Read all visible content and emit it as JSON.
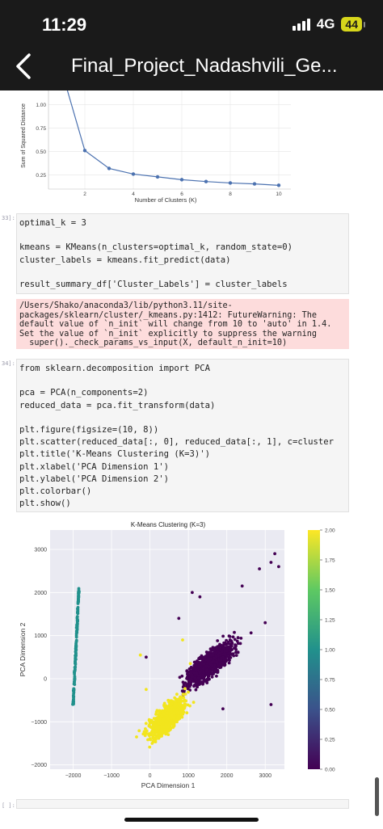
{
  "status": {
    "time": "11:29",
    "network": "4G",
    "battery": "44"
  },
  "nav": {
    "title": "Final_Project_Nadashvili_Ge..."
  },
  "elbow": {
    "ylabel": "Sum of Squared Distance",
    "xlabel": "Number of Clusters (K)",
    "x_ticks": [
      "2",
      "4",
      "6",
      "8",
      "10"
    ],
    "y_ticks": [
      "1.00",
      "0.75",
      "0.50",
      "0.25"
    ]
  },
  "cells": {
    "c33": {
      "prompt": "33]:",
      "lines": [
        "optimal_k = 3",
        "",
        "kmeans = KMeans(n_clusters=optimal_k, random_state=0)",
        "cluster_labels = kmeans.fit_predict(data)",
        "",
        "result_summary_df['Cluster_Labels'] = cluster_labels"
      ]
    },
    "warning": "/Users/Shako/anaconda3/lib/python3.11/site-\npackages/sklearn/cluster/_kmeans.py:1412: FutureWarning: The\ndefault value of `n_init` will change from 10 to 'auto' in 1.4.\nSet the value of `n_init` explicitly to suppress the warning\n  super()._check_params_vs_input(X, default_n_init=10)",
    "c34": {
      "prompt": "34]:",
      "lines": [
        "from sklearn.decomposition import PCA",
        "",
        "pca = PCA(n_components=2)",
        "reduced_data = pca.fit_transform(data)",
        "",
        "plt.figure(figsize=(10, 8))",
        "plt.scatter(reduced_data[:, 0], reduced_data[:, 1], c=cluster",
        "plt.title('K-Means Clustering (K=3)')",
        "plt.xlabel('PCA Dimension 1')",
        "plt.ylabel('PCA Dimension 2')",
        "plt.colorbar()",
        "plt.show()"
      ]
    },
    "c_empty": {
      "prompt": "[ ]:"
    }
  },
  "chart_data": [
    {
      "type": "line",
      "xlabel": "Number of Clusters (K)",
      "ylabel": "Sum of Squared Distance",
      "x": [
        1,
        2,
        3,
        4,
        5,
        6,
        7,
        8,
        9,
        10
      ],
      "y": [
        1.4,
        0.51,
        0.32,
        0.26,
        0.23,
        0.2,
        0.18,
        0.165,
        0.155,
        0.14
      ],
      "xlim": [
        0.5,
        10.5
      ],
      "ylim_visible": [
        0.1,
        1.15
      ],
      "color": "#4c72b0"
    },
    {
      "type": "scatter",
      "title": "K-Means Clustering (K=3)",
      "xlabel": "PCA Dimension 1",
      "ylabel": "PCA Dimension 2",
      "x_ticks": [
        "−2000",
        "−1000",
        "0",
        "1000",
        "2000",
        "3000"
      ],
      "y_ticks": [
        "−2000",
        "−1000",
        "0",
        "1000",
        "2000",
        "3000"
      ],
      "xlim": [
        -2600,
        3500
      ],
      "ylim": [
        -2100,
        3450
      ],
      "colorbar": {
        "ticks": [
          "0.00",
          "0.25",
          "0.50",
          "0.75",
          "1.00",
          "1.25",
          "1.50",
          "1.75",
          "2.00"
        ],
        "range": [
          0,
          2
        ]
      },
      "clusters": [
        {
          "label": 0,
          "color": "#f2e51d",
          "center": [
            450,
            -900
          ],
          "extent_note": "dense elongated cloud from about (-150,-1900) to (1000,400)"
        },
        {
          "label": 1,
          "color": "#440154",
          "center": [
            1550,
            350
          ],
          "extent_note": "dense elongated cloud from about (800,-500) to (3100,2400), sparse outliers up to (3300,2900)"
        },
        {
          "label": 2,
          "color": "#21918c",
          "center": [
            -1950,
            700
          ],
          "extent_note": "thin line from about (-2000,-600) to (-1850,2100)"
        }
      ],
      "grid": true
    }
  ]
}
